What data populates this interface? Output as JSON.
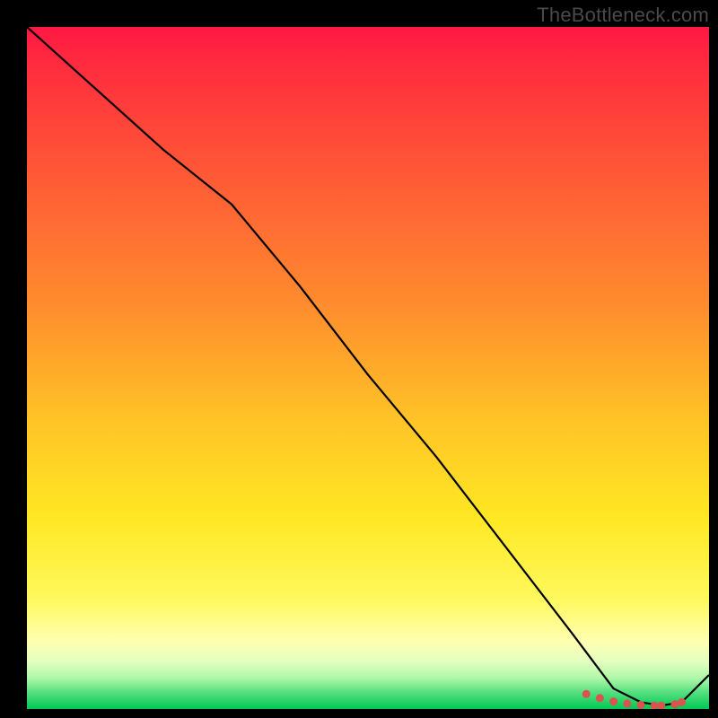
{
  "watermark": "TheBottleneck.com",
  "chart_data": {
    "type": "line",
    "title": "",
    "xlabel": "",
    "ylabel": "",
    "xlim": [
      0,
      100
    ],
    "ylim": [
      0,
      100
    ],
    "grid": false,
    "legend": false,
    "x": [
      0,
      10,
      20,
      30,
      40,
      50,
      60,
      70,
      80,
      86,
      90,
      93,
      96,
      100
    ],
    "values": [
      100,
      91,
      82,
      74,
      62,
      49,
      37,
      24,
      11,
      3,
      1,
      0.5,
      1,
      5
    ],
    "markers": {
      "x": [
        82,
        84,
        86,
        88,
        90,
        92,
        93,
        95,
        96
      ],
      "values": [
        2.2,
        1.6,
        1.1,
        0.8,
        0.6,
        0.5,
        0.5,
        0.7,
        1.0
      ]
    },
    "marker_color": "#d9534f",
    "curve_color": "#000000"
  }
}
